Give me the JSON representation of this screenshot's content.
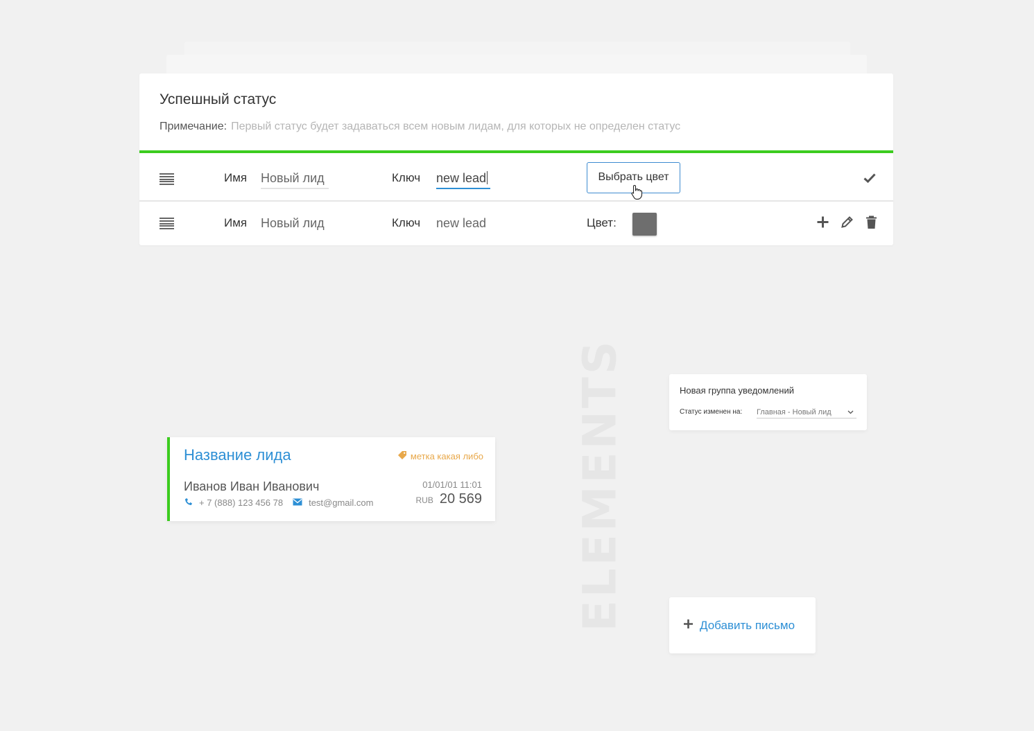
{
  "watermark": "ELEMENTS",
  "status_panel": {
    "title": "Успешный статус",
    "note_label": "Примечание:",
    "note_text": "Первый статус будет задаваться всем новым лидам, для которых не определен статус",
    "accent_color": "#3ccc1f",
    "rows": [
      {
        "name_label": "Имя",
        "name_value": "Новый лид",
        "key_label": "Ключ",
        "key_value": "new lead",
        "pick_color_button": "Выбрать цвет",
        "icons": [
          "drag-handle-icon",
          "check-icon",
          "hand-pointer-icon"
        ]
      },
      {
        "name_label": "Имя",
        "name_value": "Новый лид",
        "key_label": "Ключ",
        "key_value": "new lead",
        "color_label": "Цвет:",
        "swatch_color": "#6e6e6e",
        "icons": [
          "drag-handle-icon",
          "plus-icon",
          "pencil-icon",
          "trash-icon"
        ]
      }
    ]
  },
  "lead_card": {
    "title": "Название лида",
    "tag": "метка какая либо",
    "person": "Иванов Иван Иванович",
    "date": "01/01/01 11:01",
    "phone": "+ 7 (888) 123 456 78",
    "email": "test@gmail.com",
    "currency": "RUB",
    "amount": "20 569",
    "accent_color": "#3ccc1f",
    "link_color": "#2d8fd5",
    "tag_color": "#e8a84a"
  },
  "notify_card": {
    "title": "Новая группа уведомлений",
    "status_label": "Статус изменен на:",
    "status_value": "Главная - Новый лид"
  },
  "add_letter": {
    "label": "Добавить письмо"
  }
}
